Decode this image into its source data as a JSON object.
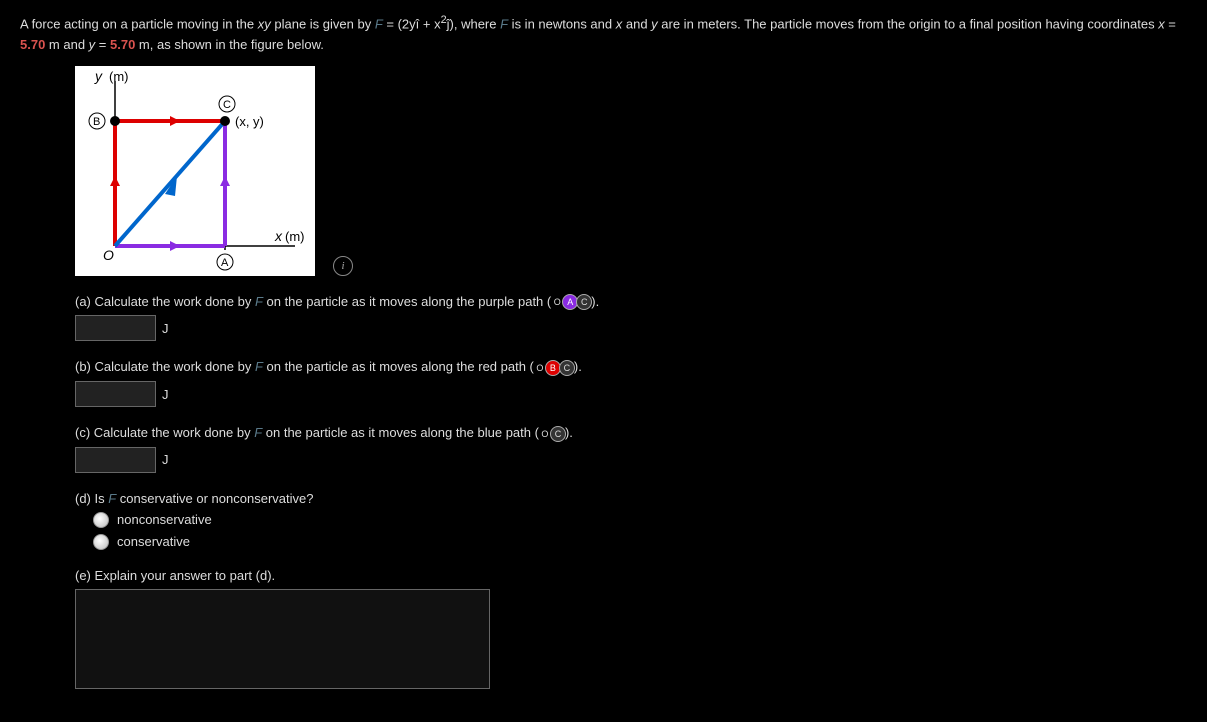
{
  "problem": {
    "intro_1": "A force acting on a particle moving in the ",
    "plane": "xy",
    "intro_2": " plane is given by ",
    "force_var": "F",
    "equals": " = (2y",
    "ihat": "î",
    "plus": " + x",
    "sq": "2",
    "jhat": "ĵ",
    "intro_3": "), where ",
    "intro_4": " is in newtons and ",
    "xvar": "x",
    "and": " and ",
    "yvar": "y",
    "intro_5": " are in meters. The particle moves from the origin to a final position having coordinates ",
    "xeq": "x",
    "eq1": " = ",
    "val1": "5.70",
    "unit1": " m and ",
    "yeq": "y",
    "eq2": " = ",
    "val2": "5.70",
    "unit2": " m, as shown in the figure below."
  },
  "figure": {
    "ylabel": "y (m)",
    "xlabel": "x (m)",
    "origin": "O",
    "pointA": "A",
    "pointB": "B",
    "pointC": "C",
    "xy": "(x, y)"
  },
  "parts": {
    "a": {
      "pre": "(a) Calculate the work done by ",
      "mid": " on the particle as it moves along the purple path (",
      "p1": "O",
      "p2": "A",
      "p3": "C",
      "post": ").",
      "unit": "J"
    },
    "b": {
      "pre": "(b) Calculate the work done by ",
      "mid": " on the particle as it moves along the red path (",
      "p1": "O",
      "p2": "B",
      "p3": "C",
      "post": ").",
      "unit": "J"
    },
    "c": {
      "pre": "(c) Calculate the work done by ",
      "mid": " on the particle as it moves along the blue path (",
      "p1": "O",
      "p2": "C",
      "post": ").",
      "unit": "J"
    },
    "d": {
      "text": "(d) Is ",
      "text2": " conservative or nonconservative?",
      "opt1": "nonconservative",
      "opt2": "conservative"
    },
    "e": {
      "text": "(e) Explain your answer to part (d)."
    }
  }
}
